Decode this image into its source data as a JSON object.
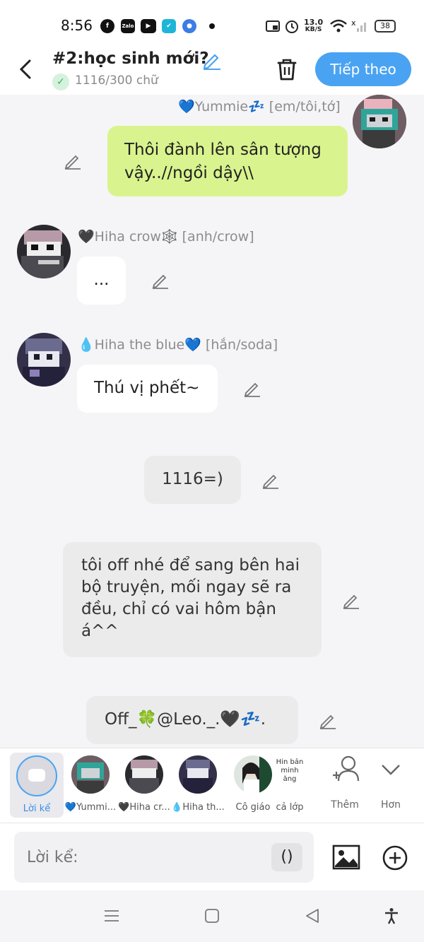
{
  "status_bar": {
    "time": "8:56",
    "app_icons": [
      "facebook-icon",
      "zalo-icon",
      "youtube-icon",
      "check-app-icon",
      "browser-icon"
    ],
    "net_speed": "13.0",
    "net_unit": "KB/S",
    "signal_mark": "x",
    "battery": "38"
  },
  "header": {
    "title": "#2:học sinh mới?",
    "word_count": "1116/300 chữ",
    "next_button": "Tiếp theo"
  },
  "messages": [
    {
      "speaker": "💙Yummie💤 [em/tôi,tớ]",
      "text": "Thôi đành lên sân tượng vậy..//ngồi dậy\\\\"
    },
    {
      "speaker": "🖤Hiha crow🕸️ [anh/crow]",
      "text": "..."
    },
    {
      "speaker": "💧Hiha the blue💙 [hắn/soda]",
      "text": "Thú vị phết~"
    },
    {
      "speaker": "",
      "text": "1116=)"
    },
    {
      "speaker": "",
      "text": "tôi off nhé để sang bên hai bộ truyện, mối ngay sẽ ra đều, chỉ có vai hôm bận á^^"
    },
    {
      "speaker": "",
      "text": "Off_🍀@Leo._.🖤💤."
    }
  ],
  "characters": {
    "narrator": "Lời kể",
    "items": [
      "💙Yummi...",
      "🖤Hiha cr...",
      "💧Hiha th...",
      "Cô giáo",
      "cả lớp"
    ],
    "thumb_text": "Hin bản minh ăng",
    "add": "Thêm",
    "more": "Hơn"
  },
  "composer": {
    "placeholder": "Lời kể:",
    "paren_button": "()"
  },
  "colors": {
    "accent": "#4aa3f2",
    "own_bubble": "#d9f48e",
    "narration_bubble": "#ebebeb",
    "bubble": "#ffffff"
  }
}
